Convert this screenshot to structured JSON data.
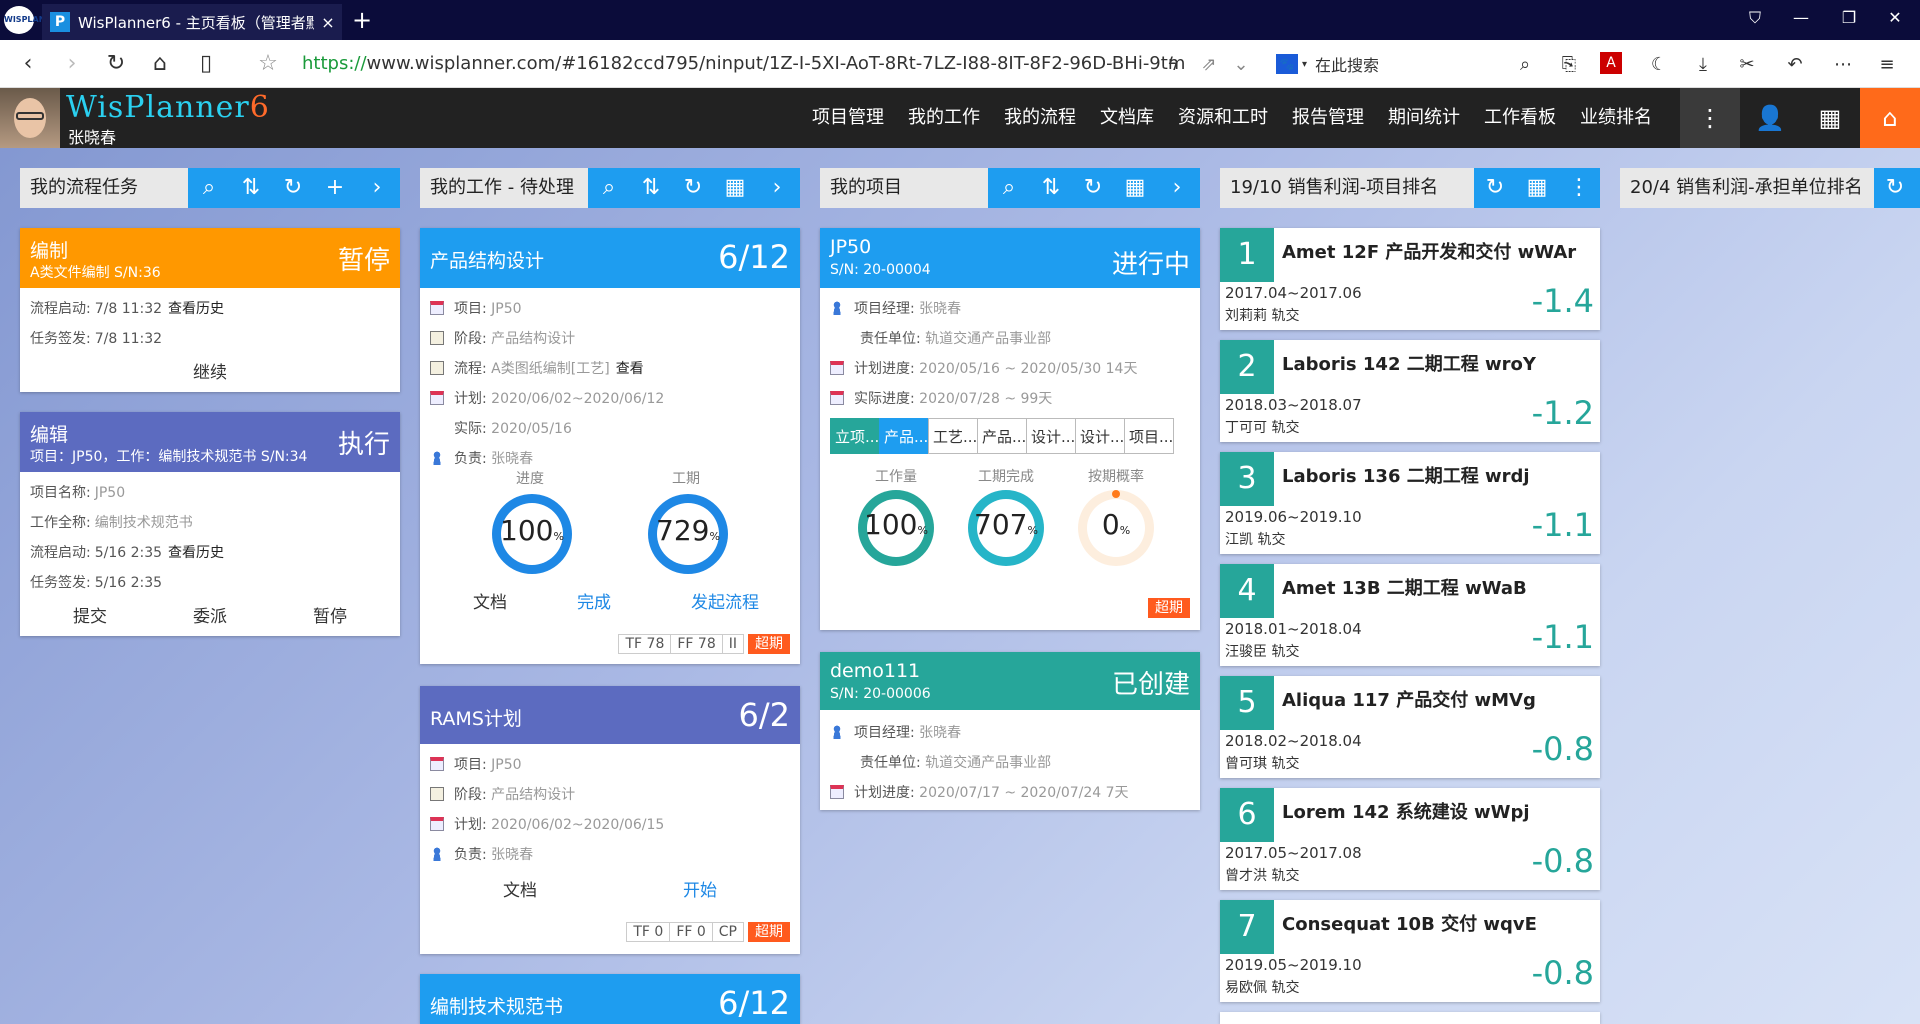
{
  "browser": {
    "tab_title": "WisPlanner6 - 主页看板（管理者默",
    "tab_close": "×",
    "new_tab": "+",
    "url_proto": "https://",
    "url_rest": "www.wisplanner.com/#16182ccd795/ninput/1Z-I-5XI-AoT-8Rt-7LZ-I88-8IT-8F2-96D-BHi-9tm",
    "search_placeholder": "在此搜索",
    "logo_text": "WISPLAN"
  },
  "app": {
    "brand_main": "WisPlanner",
    "brand_ver": "6",
    "user": "张晓春",
    "menu": [
      "项目管理",
      "我的工作",
      "我的流程",
      "文档库",
      "资源和工时",
      "报告管理",
      "期间统计",
      "工作看板",
      "业绩排名"
    ]
  },
  "columns": {
    "c1": "我的流程任务",
    "c2": "我的工作 - 待处理",
    "c3": "我的项目",
    "c4": "19/10 销售利润-项目排名",
    "c5": "20/4 销售利润-承担单位排名"
  },
  "flow": [
    {
      "title": "编制",
      "sub": "A类文件编制 S/N:36",
      "status": "暂停",
      "r1k": "流程启动:",
      "r1v": "7/8 11:32",
      "r1l": "查看历史",
      "r2k": "任务签发:",
      "r2v": "7/8 11:32",
      "act1": "继续",
      "color": "#ff9800"
    },
    {
      "title": "编辑",
      "sub": "项目：JP50，工作：编制技术规范书 S/N:34",
      "status": "执行",
      "f1k": "项目名称:",
      "f1v": "JP50",
      "f2k": "工作全称:",
      "f2v": "编制技术规范书",
      "r1k": "流程启动:",
      "r1v": "5/16 2:35",
      "r1l": "查看历史",
      "r2k": "任务签发:",
      "r2v": "5/16 2:35",
      "act1": "提交",
      "act2": "委派",
      "act3": "暂停",
      "color": "#5c6bc0"
    }
  ],
  "work": [
    {
      "title": "产品结构设计",
      "count": "6/12",
      "proj_k": "项目:",
      "proj_v": "JP50",
      "stage_k": "阶段:",
      "stage_v": "产品结构设计",
      "flow_k": "流程:",
      "flow_v": "A类图纸编制[工艺]",
      "flow_l": "查看",
      "plan_k": "计划:",
      "plan_v": "2020/06/02~2020/06/12",
      "act_k": "实际:",
      "act_v": "2020/05/16",
      "own_k": "负责:",
      "own_v": "张晓春",
      "g1_cap": "进度",
      "g1_val": "100",
      "g1_unit": "%",
      "g2_cap": "工期",
      "g2_val": "729",
      "g2_unit": "%",
      "a1": "文档",
      "a2": "完成",
      "a3": "发起流程",
      "t1": "TF 78",
      "t2": "FF 78",
      "t3": "II",
      "t4": "超期",
      "g1": 1.0,
      "g2": 1.0
    },
    {
      "title": "RAMS计划",
      "count": "6/2",
      "proj_k": "项目:",
      "proj_v": "JP50",
      "stage_k": "阶段:",
      "stage_v": "产品结构设计",
      "plan_k": "计划:",
      "plan_v": "2020/06/02~2020/06/15",
      "own_k": "负责:",
      "own_v": "张晓春",
      "a1": "文档",
      "a2": "开始",
      "t1": "TF 0",
      "t2": "FF 0",
      "t3": "CP",
      "t4": "超期"
    },
    {
      "title": "编制技术规范书",
      "count": "6/12"
    }
  ],
  "projects": [
    {
      "name": "JP50",
      "sn": "S/N: 20-00004",
      "status": "进行中",
      "pm_k": "项目经理:",
      "pm_v": "张晓春",
      "unit_k": "责任单位:",
      "unit_v": "轨道交通产品事业部",
      "plan_k": "计划进度:",
      "plan_v": "2020/05/16 ~ 2020/05/30 14天",
      "act_k": "实际进度:",
      "act_v": "2020/07/28 ~ 99天",
      "tabs": [
        "立项...",
        "产品...",
        "工艺...",
        "产品...",
        "设计...",
        "设计...",
        "项目..."
      ],
      "g1_cap": "工作量",
      "g1_val": "100",
      "g2_cap": "工期完成",
      "g2_val": "707",
      "g3_cap": "按期概率",
      "g3_val": "0",
      "unit": "%",
      "overdue": "超期",
      "g1": 1.0,
      "g2": 1.0,
      "g3": 0.0
    },
    {
      "name": "demo111",
      "sn": "S/N: 20-00006",
      "status": "已创建",
      "pm_k": "项目经理:",
      "pm_v": "张晓春",
      "unit_k": "责任单位:",
      "unit_v": "轨道交通产品事业部",
      "plan_k": "计划进度:",
      "plan_v": "2020/07/17 ~ 2020/07/24 7天"
    }
  ],
  "ranking": [
    {
      "n": "1",
      "title": "Amet 12F 产品开发和交付 wWAr",
      "period": "2017.04~2017.06",
      "who": "刘莉莉 轨交",
      "val": "-1.4"
    },
    {
      "n": "2",
      "title": "Laboris 142 二期工程 wroY",
      "period": "2018.03~2018.07",
      "who": "丁可可 轨交",
      "val": "-1.2"
    },
    {
      "n": "3",
      "title": "Laboris 136 二期工程 wrdj",
      "period": "2019.06~2019.10",
      "who": "江凯 轨交",
      "val": "-1.1"
    },
    {
      "n": "4",
      "title": "Amet 13B 二期工程 wWaB",
      "period": "2018.01~2018.04",
      "who": "汪骏臣 轨交",
      "val": "-1.1"
    },
    {
      "n": "5",
      "title": "Aliqua 117 产品交付 wMVg",
      "period": "2018.02~2018.04",
      "who": "曾可琪 轨交",
      "val": "-0.8"
    },
    {
      "n": "6",
      "title": "Lorem 142 系统建设 wWpj",
      "period": "2017.05~2017.08",
      "who": "曾才洪 轨交",
      "val": "-0.8"
    },
    {
      "n": "7",
      "title": "Consequat 10B 交付 wqvE",
      "period": "2019.05~2019.10",
      "who": "易欧佩 轨交",
      "val": "-0.8"
    }
  ]
}
